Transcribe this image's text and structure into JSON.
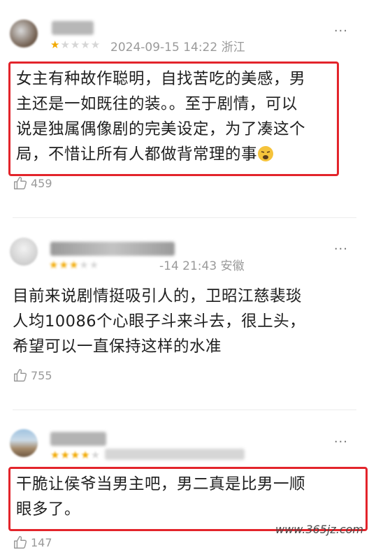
{
  "comments": [
    {
      "date": "2024-09-15 14:22",
      "region": "浙江",
      "text_lines": [
        "女主有种故作聪明，自找苦吃的美感，男",
        "主还是一如既往的装。。至于剧情，可以",
        "说是独属偶像剧的完美设定，为了凑这个",
        "局，不惜让所有人都做背常理的事"
      ],
      "likes": "459",
      "rating": 1
    },
    {
      "date": "-14 21:43",
      "region": "安徽",
      "text_lines": [
        "目前来说剧情挺吸引人的，卫昭江慈裴琰",
        "人均10086个心眼子斗来斗去，很上头，",
        "希望可以一直保持这样的水准"
      ],
      "likes": "755",
      "rating": 3
    },
    {
      "date": "",
      "region": "",
      "text_lines": [
        "干脆让侯爷当男主吧，男二真是比男一顺",
        "眼多了。"
      ],
      "likes": "147",
      "rating": 4
    }
  ],
  "more_glyph": "···",
  "star_glyph": "★",
  "emoji": "weary-face-icon",
  "watermark": "www.365jz.com",
  "colors": {
    "highlight": "#e3242b",
    "star": "#f2a900",
    "meta": "#9a9a9a"
  }
}
